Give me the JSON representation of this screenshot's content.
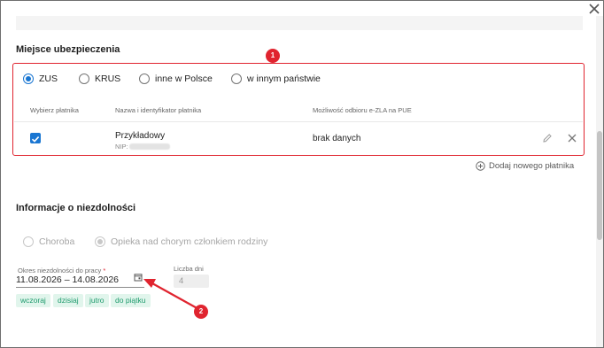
{
  "dialog": {
    "close_icon": "close-icon"
  },
  "insurance": {
    "title": "Miejsce ubezpieczenia",
    "options": [
      {
        "label": "ZUS",
        "selected": true
      },
      {
        "label": "KRUS",
        "selected": false
      },
      {
        "label": "inne w Polsce",
        "selected": false
      },
      {
        "label": "w innym państwie",
        "selected": false
      }
    ],
    "columns": {
      "select": "Wybierz płatnika",
      "name": "Nazwa i identyfikator płatnika",
      "ezla": "Możliwość odbioru e-ZLA na PUE"
    },
    "payer": {
      "checked": true,
      "name": "Przykładowy",
      "nip_label": "NIP:",
      "ezla_value": "brak danych"
    },
    "add_payer": "Dodaj nowego płatnika"
  },
  "incapacity": {
    "title": "Informacje o niezdolności",
    "types": [
      {
        "label": "Choroba",
        "selected": false
      },
      {
        "label": "Opieka nad chorym członkiem rodziny",
        "selected": true
      }
    ],
    "period_label": "Okres niezdolności do pracy",
    "required_mark": "*",
    "period_value": "11.08.2026 – 14.08.2026",
    "days_label": "Liczba dni",
    "days_value": "4",
    "quick_chips": [
      "wczoraj",
      "dzisiaj",
      "jutro",
      "do piątku"
    ]
  },
  "annotations": {
    "badge_1": "1",
    "badge_2": "2",
    "color": "#e0242f"
  },
  "colors": {
    "accent": "#1976d2",
    "chip_bg": "#e1f5ec",
    "chip_text": "#1d9a6c"
  }
}
